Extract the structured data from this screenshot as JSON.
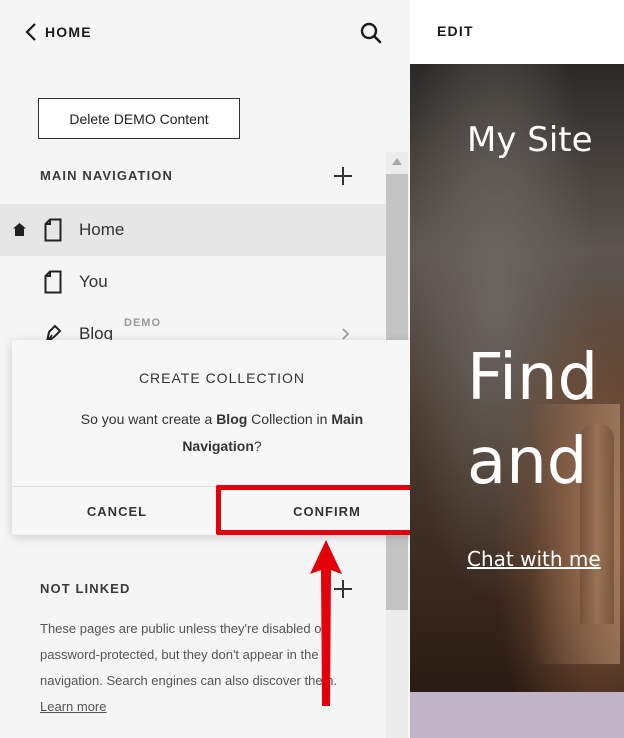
{
  "topbar": {
    "back_label": "HOME"
  },
  "demo": {
    "delete_label": "Delete DEMO Content"
  },
  "main_navigation": {
    "title": "MAIN NAVIGATION",
    "items": [
      {
        "label": "Home",
        "icon": "page-icon",
        "is_homepage": true,
        "active": true
      },
      {
        "label": "You",
        "icon": "page-icon"
      },
      {
        "label": "Blog",
        "icon": "blog-pen-icon",
        "badge": "DEMO"
      }
    ]
  },
  "not_linked": {
    "title": "NOT LINKED",
    "description": "These pages are public unless they're disabled or password-protected, but they don't appear in the navigation. Search engines can also discover them.",
    "learn_more": "Learn more"
  },
  "dialog": {
    "title": "CREATE COLLECTION",
    "body_prefix": "So you want create a ",
    "body_bold_1": "Blog",
    "body_mid": " Collection in ",
    "body_bold_2": "Main Navigation",
    "body_suffix": "?",
    "cancel_label": "CANCEL",
    "confirm_label": "CONFIRM"
  },
  "preview": {
    "edit_label": "EDIT",
    "site_title": "My Site",
    "hero_heading": "Find\nand",
    "hero_link": "Chat with me"
  },
  "colors": {
    "highlight": "#e3000b",
    "panel_bg": "#f5f5f5",
    "active_row": "#e6e6e6"
  }
}
